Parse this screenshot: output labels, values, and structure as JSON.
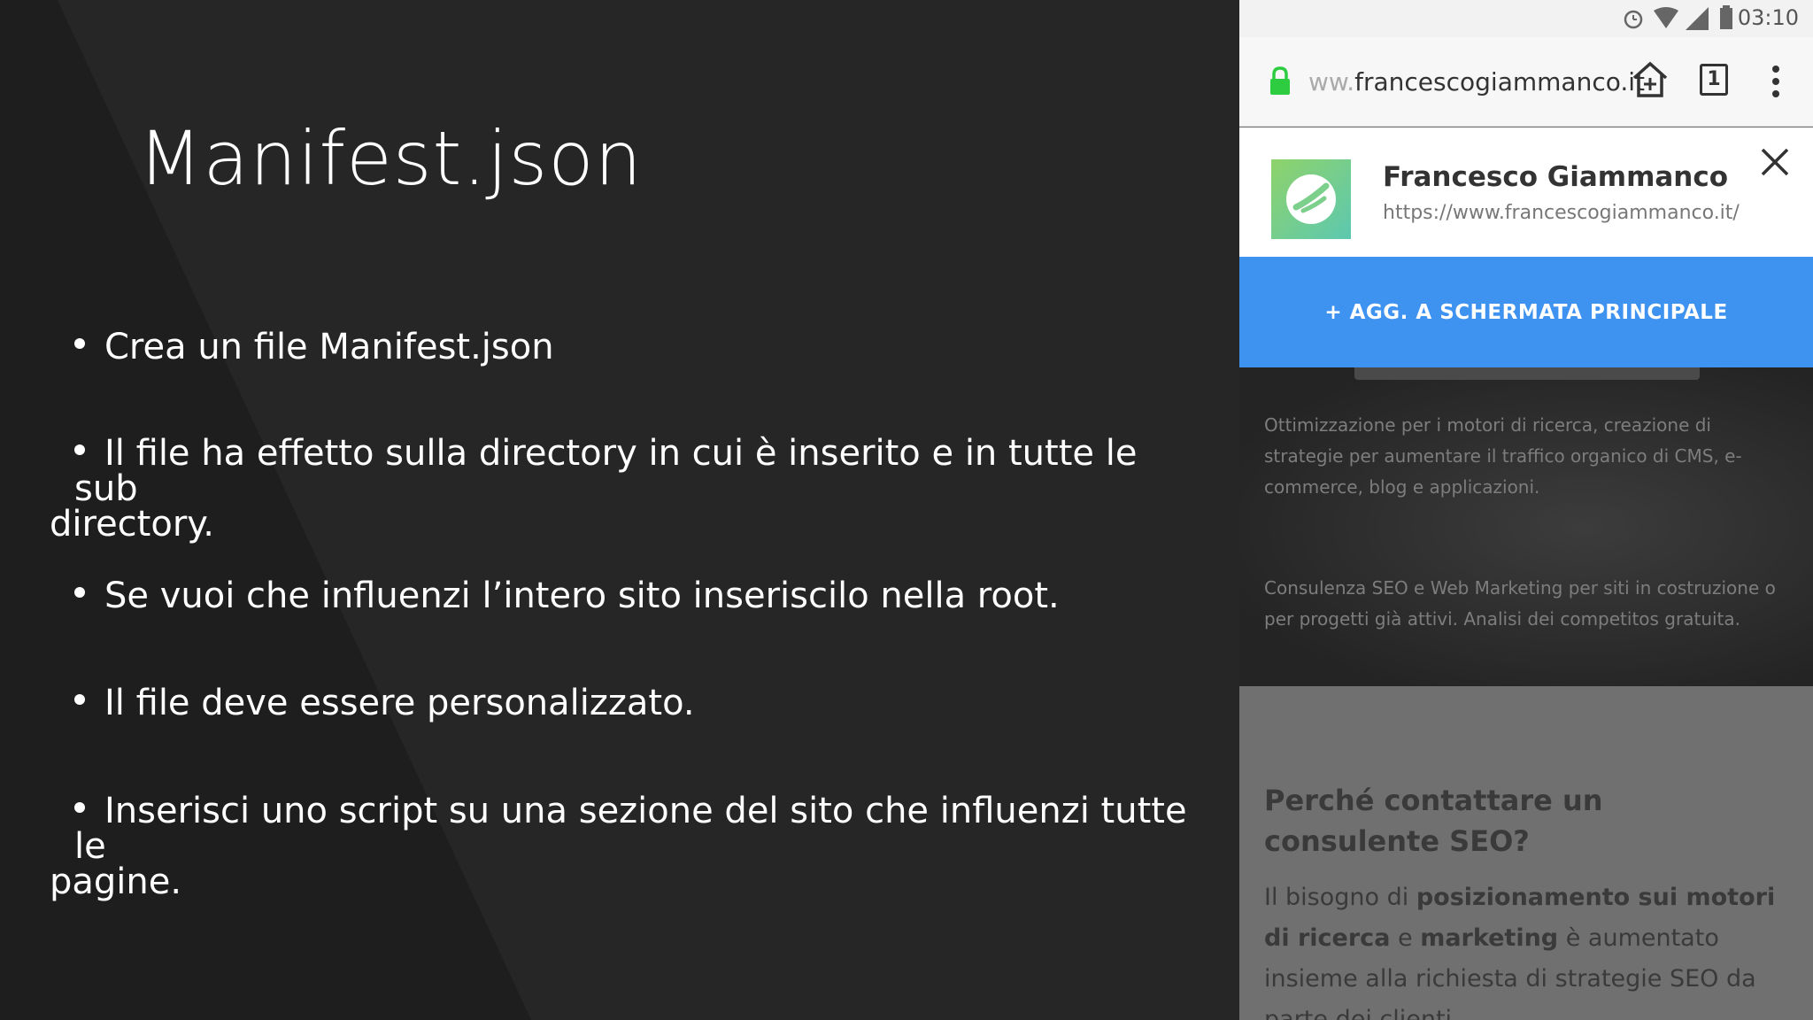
{
  "slide": {
    "title": "Manifest.json",
    "bullets": [
      {
        "line1": "Crea un file Manifest.json",
        "line2": ""
      },
      {
        "line1": "Il file ha effetto sulla directory in cui è inserito e in tutte le sub",
        "line2": "directory."
      },
      {
        "line1": "Se vuoi che influenzi l’intero sito inseriscilo nella root.",
        "line2": ""
      },
      {
        "line1": "Il file deve essere personalizzato.",
        "line2": ""
      },
      {
        "line1": "Inserisci uno script su una sezione del sito che influenzi tutte le",
        "line2": "pagine."
      }
    ]
  },
  "phone": {
    "status": {
      "time": "03:10",
      "icons": [
        "alarm-icon",
        "wifi-icon",
        "signal-icon",
        "battery-icon"
      ]
    },
    "browser": {
      "url_prefix": "ww.",
      "url_main": "francescogiammanco.it",
      "tab_count": "1",
      "icons": [
        "lock-icon",
        "home-add-icon",
        "tabs-icon",
        "more-vert-icon"
      ]
    },
    "banner": {
      "site_name": "Francesco Giammanco",
      "site_url": "https://www.francescogiammanco.it/",
      "add_button": "+ AGG. A SCHERMATA PRINCIPALE"
    },
    "hero": {
      "para1": "Ottimizzazione per i motori di ricerca, creazione di strategie per aumentare il traffico organico di CMS, e-commerce, blog e applicazioni.",
      "para2": "Consulenza SEO e Web Marketing per siti in costruzione o per progetti già attivi. Analisi dei competitos gratuita."
    },
    "section": {
      "heading": "Perché contattare un consulente SEO?",
      "text_a": "Il bisogno di ",
      "text_b": "posizionamento sui motori di ricerca",
      "text_c": " e ",
      "text_d": "marketing",
      "text_e": " è aumentato insieme alla richiesta di strategie SEO da parte dei clienti."
    },
    "colors": {
      "accent": "#3f93f0",
      "lock": "#2ecc40"
    }
  }
}
